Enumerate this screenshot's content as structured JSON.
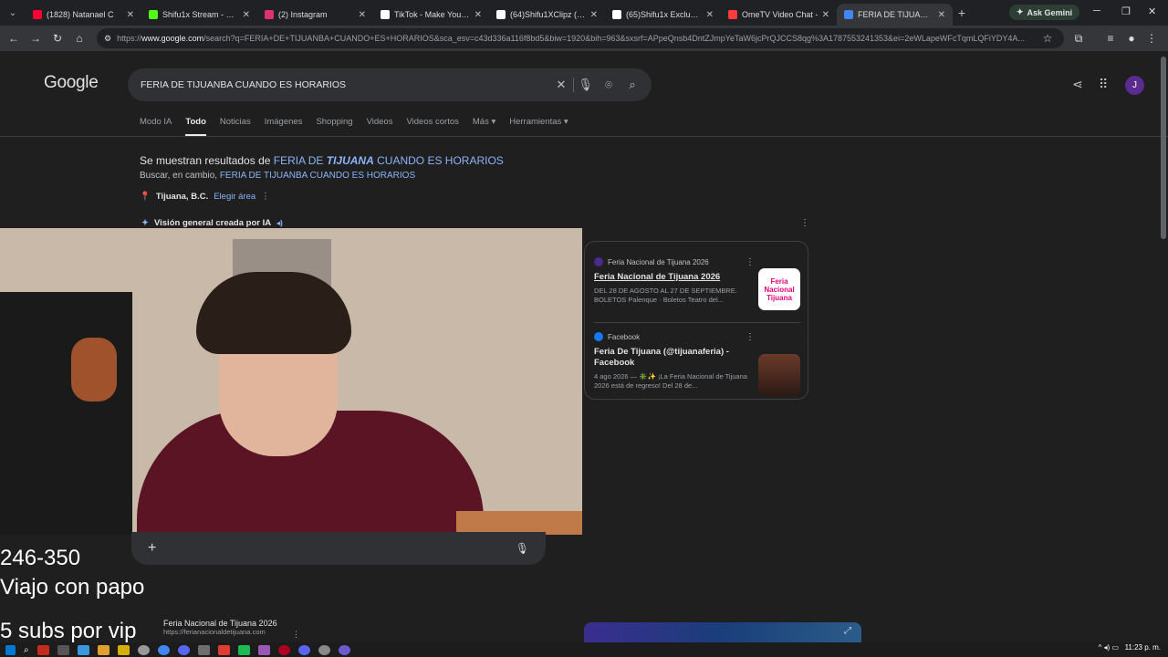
{
  "tabs": [
    {
      "title": "(1828) Natanael C",
      "color": "#ff0033"
    },
    {
      "title": "Shifu1x Stream - Watc",
      "color": "#53fc18"
    },
    {
      "title": "(2) Instagram",
      "color": "#e1306c"
    },
    {
      "title": "TikTok - Make Your Da",
      "color": "#ffffff"
    },
    {
      "title": "(64)Shifu1XClipz (@sh",
      "color": "#ffffff"
    },
    {
      "title": "(65)Shifu1x Exclusive (",
      "color": "#ffffff"
    },
    {
      "title": "OmeTV Video Chat -",
      "color": "#ff3b3b"
    },
    {
      "title": "FERIA DE TIJUANBA C",
      "color": "#4285f4",
      "active": true
    }
  ],
  "ask_gemini": "Ask Gemini",
  "address": {
    "prefix": "https://",
    "domain": "www.google.com",
    "rest": "/search?q=FERIA+DE+TIJUANBA+CUANDO+ES+HORARIOS&sca_esv=c43d336a116f8bd5&biw=1920&bih=963&sxsrf=APpeQnsb4DntZJmpYeTaW6jcPrQJCCS8qg%3A1787553241353&ei=2eWLapeWFcTqmLQFiYDY4A..."
  },
  "google": {
    "logo": "Google",
    "query": "FERIA DE TIJUANBA CUANDO ES HORARIOS",
    "tabs": [
      "Modo IA",
      "Todo",
      "Noticias",
      "Imágenes",
      "Shopping",
      "Videos",
      "Videos cortos",
      "Más ▾",
      "Herramientas ▾"
    ],
    "avatar_letter": "J"
  },
  "spelling": {
    "showing_prefix": "Se muestran resultados de ",
    "corrected_a": "FERIA DE ",
    "corrected_b": "TIJUANA",
    "corrected_c": " CUANDO ES HORARIOS",
    "instead_prefix": "Buscar, en cambio, ",
    "original": "FERIA DE TIJUANBA CUANDO ES HORARIOS"
  },
  "location": {
    "city": "Tijuana, B.C.",
    "choose": "Elegir área"
  },
  "ai_overview": "Visión general creada por IA",
  "cards": [
    {
      "source": "Feria Nacional de Tijuana 2026",
      "title": "Feria Nacional de Tijuana 2026",
      "snippet": "DEL 28 DE AGOSTO AL 27 DE SEPTIEMBRE. BOLETOS Palenque · Boletos Teatro del...",
      "thumb_text": "Feria Nacional Tijuana"
    },
    {
      "source": "Facebook",
      "title": "Feria De Tijuana (@tijuanaferia) - Facebook",
      "snippet": "4 ago 2026 — ✳️✨ ¡La Feria Nacional de Tijuana 2026 está de regreso! Del 28 de..."
    }
  ],
  "overlay": {
    "line1": "246-350",
    "line2": "Viajo con papo",
    "line3": "5 subs por vip"
  },
  "bottom_result": {
    "title": "Feria Nacional de Tijuana 2026",
    "url": "https://ferianacionaldetijuana.com"
  },
  "clock": "11:23 p. m.",
  "tray": "^  ◂)  ▭"
}
